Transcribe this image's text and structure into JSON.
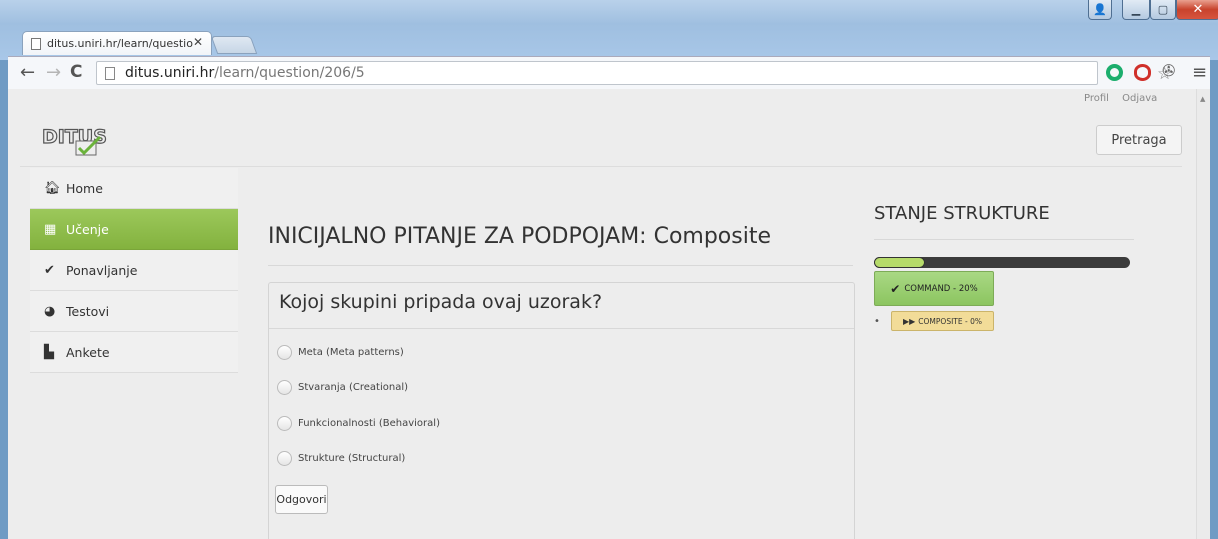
{
  "browser": {
    "tab_title": "ditus.uniri.hr/learn/questio",
    "tab_close": "✕",
    "url_domain": "ditus.uniri.hr",
    "url_path": "/learn/question/206/5"
  },
  "header": {
    "links": [
      "Profil",
      "Odjava"
    ],
    "search_label": "Pretraga"
  },
  "sidebar": {
    "items": [
      {
        "label": "Home",
        "icon": "home-icon"
      },
      {
        "label": "Učenje",
        "icon": "book-icon",
        "active": true
      },
      {
        "label": "Ponavljanje",
        "icon": "check-icon"
      },
      {
        "label": "Testovi",
        "icon": "pie-chart-icon"
      },
      {
        "label": "Ankete",
        "icon": "clipboard-icon"
      }
    ]
  },
  "main": {
    "title": "INICIJALNO PITANJE ZA PODPOJAM: Composite",
    "question": "Kojoj skupini pripada ovaj uzorak?",
    "options": [
      "Meta (Meta patterns)",
      "Stvaranja (Creational)",
      "Funkcionalnosti (Behavioral)",
      "Strukture (Structural)"
    ],
    "submit_label": "Odgovori"
  },
  "structure": {
    "title": "STANJE STRUKTURE",
    "progress_percent": 20,
    "done_concept": "COMMAND - 20%",
    "bullet": "•",
    "current_concept": "COMPOSITE - 0%"
  },
  "colors": {
    "active_green": "#8dbb47",
    "progress_fill": "#b6db6a",
    "current_yellow": "#f2dc98"
  }
}
